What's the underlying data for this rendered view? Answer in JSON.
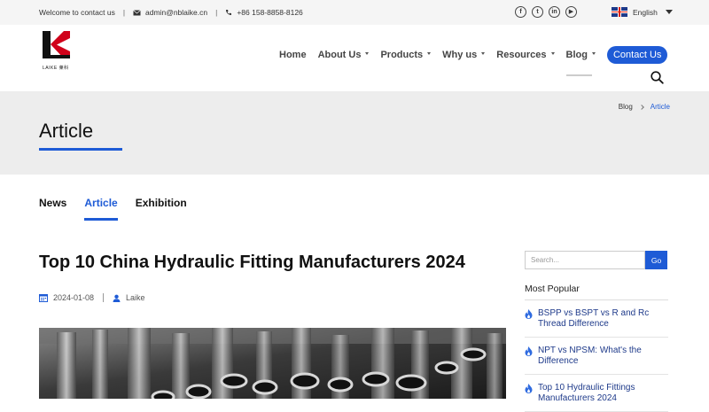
{
  "topbar": {
    "welcome": "Welcome to contact us",
    "email": "admin@nblaike.cn",
    "phone": "+86 158-8858-8126",
    "social": [
      "facebook-icon",
      "twitter-icon",
      "linkedin-icon",
      "youtube-icon"
    ],
    "language": "English"
  },
  "logo": {
    "text": "LAIKE 莱科"
  },
  "nav": {
    "items": [
      {
        "label": "Home",
        "dropdown": false
      },
      {
        "label": "About Us",
        "dropdown": true
      },
      {
        "label": "Products",
        "dropdown": true
      },
      {
        "label": "Why us",
        "dropdown": true
      },
      {
        "label": "Resources",
        "dropdown": true
      },
      {
        "label": "Blog",
        "dropdown": true
      }
    ],
    "contact_label": "Contact Us"
  },
  "banner": {
    "title": "Article",
    "breadcrumb": [
      "Blog",
      "Article"
    ]
  },
  "tabs": [
    "News",
    "Article",
    "Exhibition"
  ],
  "article": {
    "title": "Top 10 China Hydraulic Fitting Manufacturers 2024",
    "date": "2024-01-08",
    "author": "Laike"
  },
  "sidebar": {
    "search_placeholder": "Search...",
    "search_button": "Go",
    "popular_heading": "Most Popular",
    "popular": [
      "BSPP vs BSPT vs R and Rc Thread Difference",
      "NPT vs NPSM: What's the Difference",
      "Top 10 Hydraulic Fittings Manufacturers 2024"
    ]
  },
  "colors": {
    "accent": "#1e5bd6",
    "flame": "#2f6be0"
  }
}
